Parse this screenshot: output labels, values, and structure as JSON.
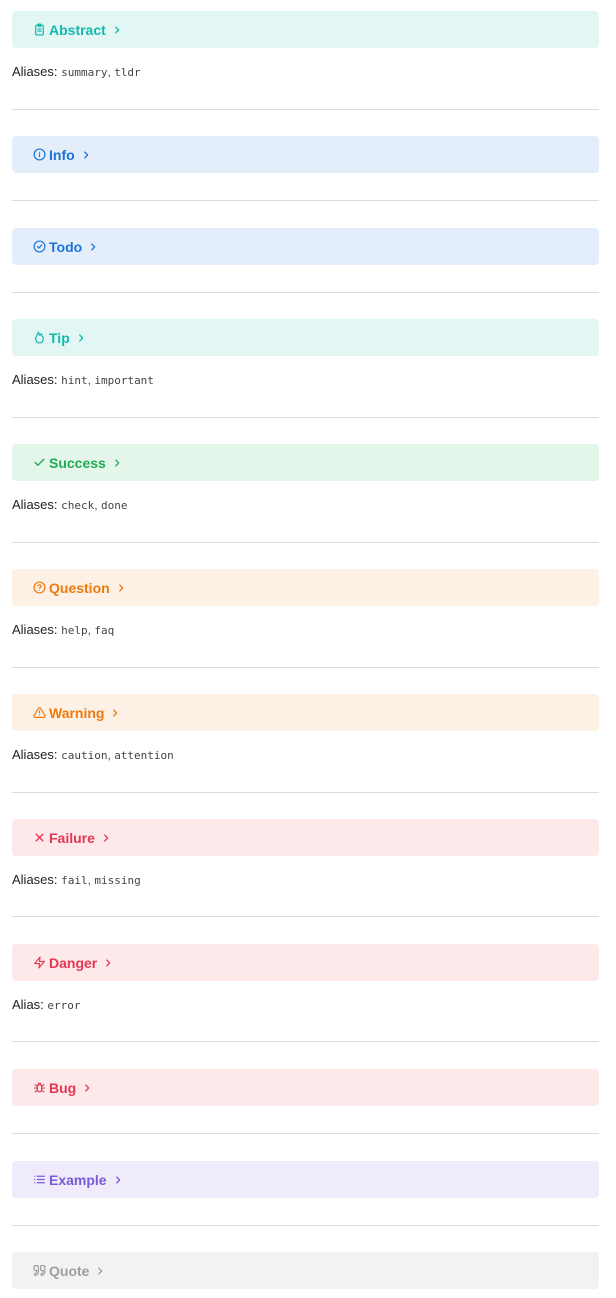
{
  "callouts": [
    {
      "title": "Abstract",
      "icon": "clipboard-icon",
      "color": "#12b8ad",
      "bg": "#e2f7f4",
      "aliases_label": "Aliases:",
      "aliases": [
        "summary",
        "tldr"
      ]
    },
    {
      "title": "Info",
      "icon": "info-circle-icon",
      "color": "#1a73d9",
      "bg": "#e4eefb",
      "aliases_label": "",
      "aliases": []
    },
    {
      "title": "Todo",
      "icon": "check-circle-icon",
      "color": "#1a73d9",
      "bg": "#e4eefb",
      "aliases_label": "",
      "aliases": []
    },
    {
      "title": "Tip",
      "icon": "flame-icon",
      "color": "#12b8ad",
      "bg": "#e2f7f4",
      "aliases_label": "Aliases:",
      "aliases": [
        "hint",
        "important"
      ]
    },
    {
      "title": "Success",
      "icon": "checkmark-icon",
      "color": "#1fad52",
      "bg": "#e4f6ea",
      "aliases_label": "Aliases:",
      "aliases": [
        "check",
        "done"
      ]
    },
    {
      "title": "Question",
      "icon": "help-circle-icon",
      "color": "#ec7a0f",
      "bg": "#fdf0e4",
      "aliases_label": "Aliases:",
      "aliases": [
        "help",
        "faq"
      ]
    },
    {
      "title": "Warning",
      "icon": "alert-triangle-icon",
      "color": "#ec7a0f",
      "bg": "#fdf0e4",
      "aliases_label": "Aliases:",
      "aliases": [
        "caution",
        "attention"
      ]
    },
    {
      "title": "Failure",
      "icon": "x-icon",
      "color": "#e53852",
      "bg": "#fde8ea",
      "aliases_label": "Aliases:",
      "aliases": [
        "fail",
        "missing"
      ]
    },
    {
      "title": "Danger",
      "icon": "zap-icon",
      "color": "#e53852",
      "bg": "#fde8ea",
      "aliases_label": "Alias:",
      "aliases": [
        "error"
      ]
    },
    {
      "title": "Bug",
      "icon": "bug-icon",
      "color": "#e53852",
      "bg": "#fde8ea",
      "aliases_label": "",
      "aliases": []
    },
    {
      "title": "Example",
      "icon": "list-icon",
      "color": "#7b5ad6",
      "bg": "#efebfb",
      "aliases_label": "",
      "aliases": []
    },
    {
      "title": "Quote",
      "icon": "quote-icon",
      "color": "#9e9e9e",
      "bg": "#f2f2f2",
      "aliases_label": "",
      "aliases": []
    }
  ]
}
